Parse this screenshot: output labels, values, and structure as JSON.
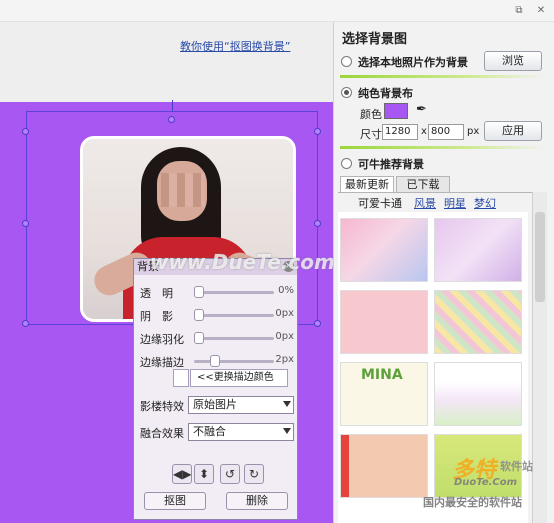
{
  "window": {
    "restore_glyph": "⧉",
    "close_glyph": "✕"
  },
  "canvas": {
    "tutorial_link": "教你使用“抠图换背景”",
    "background_color": "#a857f2"
  },
  "popup": {
    "title": "背景",
    "rows": [
      {
        "label": "透　明",
        "value": "0%",
        "level": 0.0
      },
      {
        "label": "阴　影",
        "value": "0px",
        "level": 0.0
      },
      {
        "label": "边缘羽化",
        "value": "0px",
        "level": 0.0
      },
      {
        "label": "边缘描边",
        "value": "2px",
        "level": 0.2
      }
    ],
    "change_border_color": "<<更换描边颜色",
    "effect_label": "影楼特效",
    "effect_value": "原始图片",
    "blend_label": "融合效果",
    "blend_value": "不融合",
    "icons": [
      "flip-horizontal-icon",
      "flip-vertical-icon",
      "rotate-left-icon",
      "rotate-right-icon"
    ],
    "cutout_button": "抠图",
    "delete_button": "删除"
  },
  "panel": {
    "title": "选择背景图",
    "option_local": "选择本地照片作为背景",
    "browse_button": "浏览",
    "option_solid": "纯色背景布",
    "color_label": "颜色",
    "color_value": "#a857f2",
    "size_label": "尺寸",
    "width_value": "1280",
    "x_sep": "x",
    "height_value": "800",
    "unit": "px",
    "apply_button": "应用",
    "option_recommended": "可牛推荐背景",
    "tabs": [
      "最新更新",
      "已下载"
    ],
    "subcategories": [
      "可爱卡通",
      "风景",
      "明星",
      "梦幻"
    ]
  },
  "thumbnails": [
    {
      "name": "pink-flowers"
    },
    {
      "name": "purple-dream"
    },
    {
      "name": "pink-cartoon"
    },
    {
      "name": "yellow-pattern"
    },
    {
      "name": "mina-cartoon",
      "text": "MINA"
    },
    {
      "name": "colorful-flowers"
    },
    {
      "name": "red-notebook"
    },
    {
      "name": "green-notebook"
    }
  ],
  "watermarks": {
    "center": "www.DueTe.com",
    "bottom_brand": "多特",
    "bottom_brand2": "软件站",
    "bottom_url": "DuoTe.Com",
    "bottom_tagline": "国内最安全的软件站"
  }
}
